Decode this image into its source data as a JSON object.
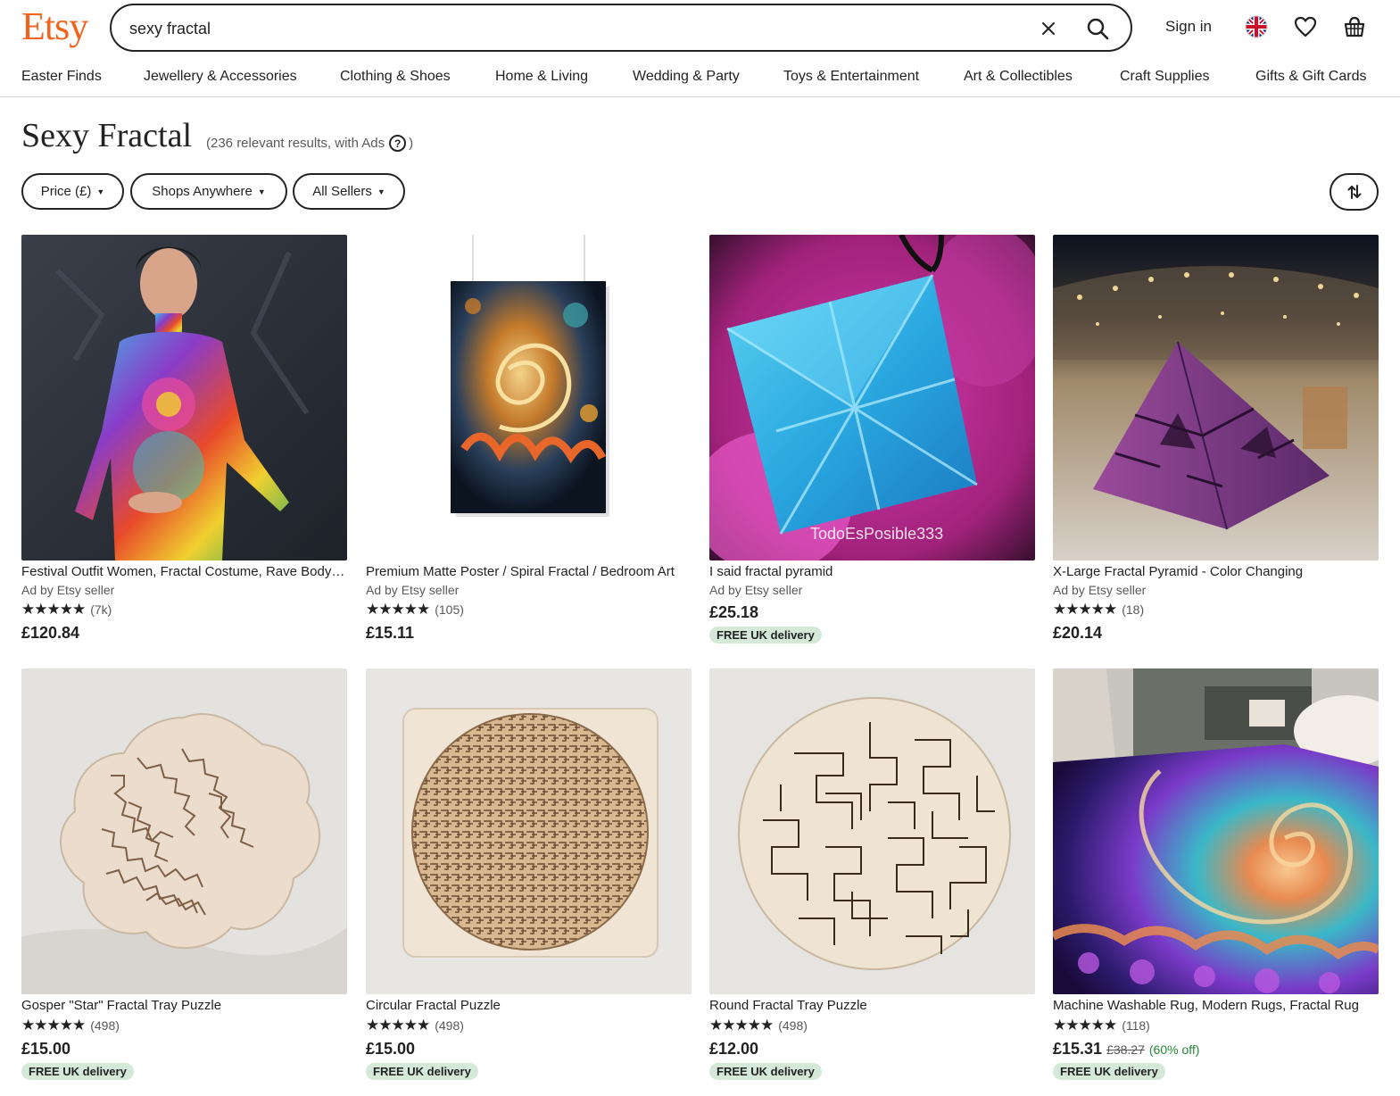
{
  "header": {
    "logo": "Etsy",
    "search_value": "sexy fractal",
    "sign_in": "Sign in"
  },
  "nav": [
    "Easter Finds",
    "Jewellery & Accessories",
    "Clothing & Shoes",
    "Home & Living",
    "Wedding & Party",
    "Toys & Entertainment",
    "Art & Collectibles",
    "Craft Supplies",
    "Gifts & Gift Cards"
  ],
  "page": {
    "title": "Sexy Fractal",
    "results": "(236 relevant results, with Ads",
    "results_end": ")"
  },
  "filters": {
    "price": "Price (£)",
    "shops": "Shops Anywhere",
    "sellers": "All Sellers"
  },
  "products": [
    {
      "title": "Festival Outfit Women, Fractal Costume, Rave Bodysuit",
      "ad": "Ad by Etsy seller",
      "stars": "★★★★★",
      "reviews": "(7k)",
      "price": "£120.84",
      "orig": "",
      "discount": "",
      "badge": "",
      "rating": 5
    },
    {
      "title": "Premium Matte Poster / Spiral Fractal / Bedroom Art",
      "ad": "Ad by Etsy seller",
      "stars": "★★★★★",
      "reviews": "(105)",
      "price": "£15.11",
      "orig": "",
      "discount": "",
      "badge": "",
      "rating": 5
    },
    {
      "title": "I said fractal pyramid",
      "ad": "Ad by Etsy seller",
      "stars": "",
      "reviews": "",
      "price": "£25.18",
      "orig": "",
      "discount": "",
      "badge": "FREE UK delivery",
      "watermark": "TodoEsPosible333"
    },
    {
      "title": "X-Large Fractal Pyramid - Color Changing",
      "ad": "Ad by Etsy seller",
      "stars": "★★★★★",
      "reviews": "(18)",
      "price": "£20.14",
      "orig": "",
      "discount": "",
      "badge": "",
      "rating": 5
    },
    {
      "title": "Gosper \"Star\" Fractal Tray Puzzle",
      "ad": "",
      "stars": "★★★★★",
      "reviews": "(498)",
      "price": "£15.00",
      "orig": "",
      "discount": "",
      "badge": "FREE UK delivery",
      "rating": 5
    },
    {
      "title": "Circular Fractal Puzzle",
      "ad": "",
      "stars": "★★★★★",
      "reviews": "(498)",
      "price": "£15.00",
      "orig": "",
      "discount": "",
      "badge": "FREE UK delivery",
      "rating": 5
    },
    {
      "title": "Round Fractal Tray Puzzle",
      "ad": "",
      "stars": "★★★★★",
      "reviews": "(498)",
      "price": "£12.00",
      "orig": "",
      "discount": "",
      "badge": "FREE UK delivery",
      "rating": 5
    },
    {
      "title": "Machine Washable Rug, Modern Rugs, Fractal Rug",
      "ad": "",
      "stars": "★★★★★",
      "reviews": "(118)",
      "price": "£15.31",
      "orig": "£38.27",
      "discount": "(60% off)",
      "badge": "FREE UK delivery",
      "rating": 5
    }
  ],
  "colors": {
    "brand": "#F1641E",
    "badge_bg": "#D4E9D7",
    "discount": "#258635"
  }
}
